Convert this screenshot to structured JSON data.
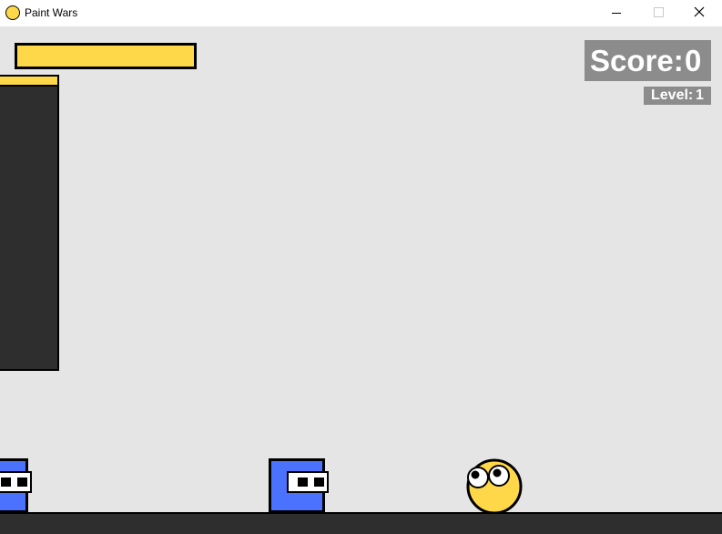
{
  "window": {
    "title": "Paint Wars",
    "app_icon": "yellow-circle-icon",
    "controls": {
      "minimize_icon": "minimize-icon",
      "maximize_icon": "maximize-icon",
      "close_icon": "close-icon"
    }
  },
  "hud": {
    "paint_meter": {
      "level": 1.0,
      "color": "#ffd84a"
    },
    "score": {
      "label": "Score:",
      "value": "0"
    },
    "level": {
      "label": "Level:",
      "value": "1"
    }
  },
  "colors": {
    "background": "#e5e5e5",
    "paint": "#ffd84a",
    "dark": "#2e2e2e",
    "enemy": "#4a72ff",
    "hud": "#8c8c8c"
  }
}
